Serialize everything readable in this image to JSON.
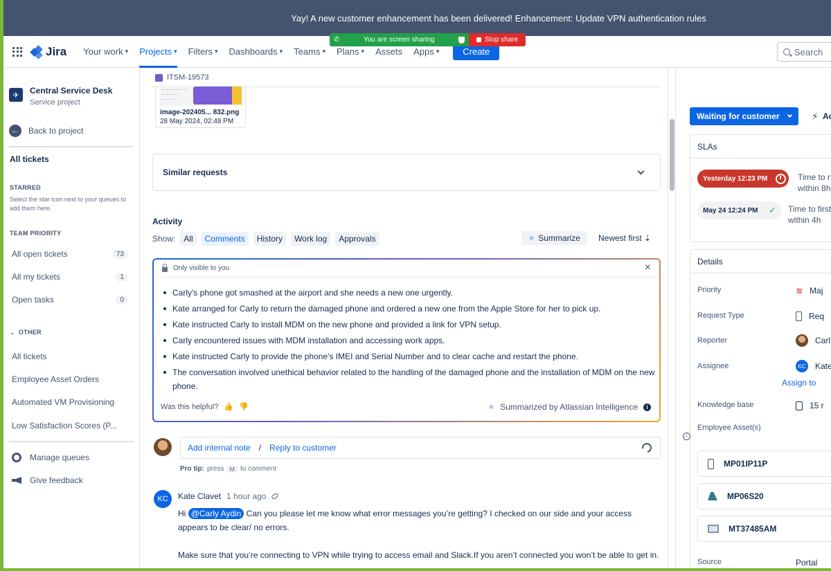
{
  "banner": {
    "message": "Yay! A new customer enhancement has been delivered! Enhancement: Update VPN authentication rules"
  },
  "screen_share": {
    "status": "You are screen sharing",
    "stop_label": "Stop share"
  },
  "nav": {
    "logo": "Jira",
    "items": [
      "Your work",
      "Projects",
      "Filters",
      "Dashboards",
      "Teams",
      "Plans",
      "Assets",
      "Apps"
    ],
    "active": "Projects",
    "create_label": "Create",
    "search_placeholder": "Search"
  },
  "sidebar": {
    "project_name": "Central Service Desk",
    "project_type": "Service project",
    "back_label": "Back to project",
    "all_tickets": "All tickets",
    "starred_heading": "STARRED",
    "starred_note": "Select the star icon next to your queues to add them here.",
    "team_priority_heading": "TEAM PRIORITY",
    "team_queues": [
      {
        "label": "All open tickets",
        "count": "73"
      },
      {
        "label": "All my tickets",
        "count": "1"
      },
      {
        "label": "Open tasks",
        "count": "0"
      }
    ],
    "other_heading": "OTHER",
    "other_queues": [
      "All tickets",
      "Employee Asset Orders",
      "Automated VM Provisioning",
      "Low Satisfaction Scores (P..."
    ],
    "manage_queues": "Manage queues",
    "give_feedback": "Give feedback"
  },
  "issue": {
    "key": "ITSM-19573",
    "attachment": {
      "name": "image-202405... 832.png",
      "date": "28 May 2024, 02:48 PM"
    },
    "similar_requests": "Similar requests"
  },
  "activity": {
    "title": "Activity",
    "show_label": "Show:",
    "filters": [
      "All",
      "Comments",
      "History",
      "Work log",
      "Approvals"
    ],
    "selected_filter": "Comments",
    "summarize_label": "Summarize",
    "sort_label": "Newest first"
  },
  "ai_summary": {
    "visibility": "Only visible to you",
    "bullets": [
      "Carly's phone got smashed at the airport and she needs a new one urgently.",
      "Kate arranged for Carly to return the damaged phone and ordered a new one from the Apple Store for her to pick up.",
      "Kate instructed Carly to install MDM on the new phone and provided a link for VPN setup.",
      "Carly encountered issues with MDM installation and accessing work apps.",
      "Kate instructed Carly to provide the phone's IMEI and Serial Number and to clear cache and restart the phone.",
      "The conversation involved unethical behavior related to the handling of the damaged phone and the installation of MDM on the new phone."
    ],
    "helpful_label": "Was this helpful?",
    "by_label": "Summarized by Atlassian Intelligence"
  },
  "reply": {
    "internal_note": "Add internal note",
    "separator": "/",
    "reply_customer": "Reply to customer",
    "protip_prefix": "Pro tip:",
    "protip_press": "press",
    "protip_key": "M",
    "protip_suffix": "to comment"
  },
  "comment": {
    "initials": "KC",
    "author": "Kate Clavet",
    "time": "1 hour ago",
    "greeting": "Hi",
    "mention": "@Carly Aydin",
    "text1": " Can you please let me know what error messages you’re getting? I checked on our side and your access appears to be clear/ no errors.",
    "text2": "Make sure that you’re connecting to VPN while trying to access email and Slack.If you aren’t connected you won’t be able to get in."
  },
  "right_panel": {
    "status": "Waiting for customer",
    "action_label": "Ac",
    "sla_heading": "SLAs",
    "slas": [
      {
        "badge": "Yesterday 12:23 PM",
        "line1": "Time to r",
        "line2": "within 8h"
      },
      {
        "badge": "May 24 12:24 PM",
        "line1": "Time to first",
        "line2": "within 4h"
      }
    ],
    "details_heading": "Details",
    "details": {
      "priority_label": "Priority",
      "priority_value": "Maj",
      "request_type_label": "Request Type",
      "request_type_value": "Req",
      "reporter_label": "Reporter",
      "reporter_value": "Carl",
      "assignee_label": "Assignee",
      "assignee_initials": "KC",
      "assignee_value": "Kate",
      "assign_to_me": "Assign to",
      "kb_label": "Knowledge base",
      "kb_value": "15 r",
      "assets_label": "Employee Asset(s)",
      "assets": [
        "MP01IP11P",
        "MP06S20",
        "MT37485AM"
      ],
      "source_label": "Source",
      "source_value": "Portal"
    }
  }
}
